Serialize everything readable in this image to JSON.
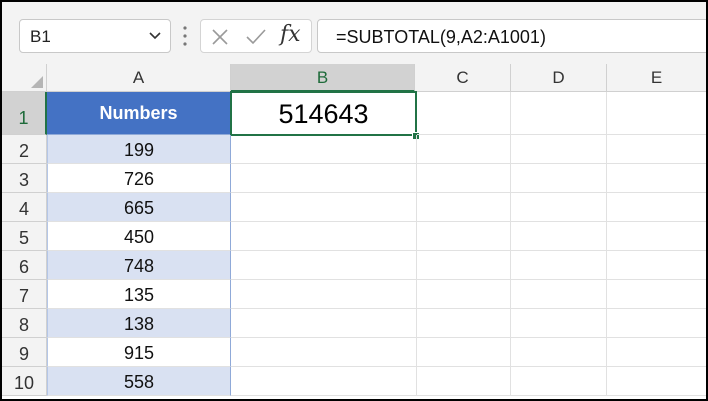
{
  "formula_bar": {
    "name_box": "B1",
    "fx_label": "fx",
    "formula": "=SUBTOTAL(9,A2:A1001)"
  },
  "grid": {
    "columns": [
      "A",
      "B",
      "C",
      "D",
      "E"
    ],
    "rows": [
      "1",
      "2",
      "3",
      "4",
      "5",
      "6",
      "7",
      "8",
      "9",
      "10"
    ],
    "a_header": "Numbers",
    "a_values": [
      "199",
      "726",
      "665",
      "450",
      "748",
      "135",
      "138",
      "915",
      "558"
    ],
    "b1_value": "514643"
  },
  "colors": {
    "header_fill": "#4472c4",
    "band_fill": "#d9e1f2",
    "selection": "#217346"
  },
  "icons": [
    "chevron-down-icon",
    "cancel-icon",
    "enter-icon",
    "fx-icon"
  ]
}
